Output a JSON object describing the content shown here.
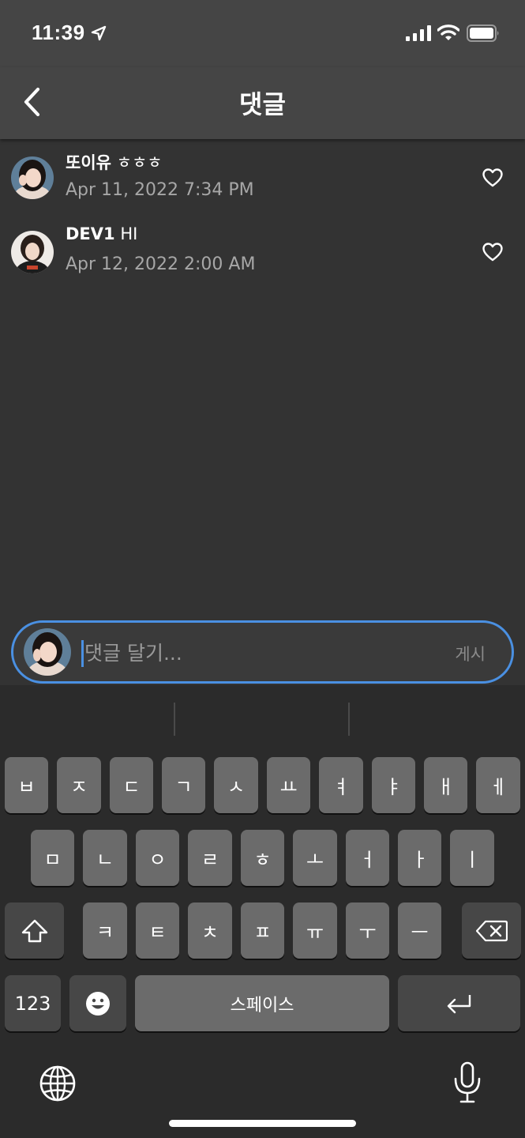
{
  "status_bar": {
    "time": "11:39",
    "icons": [
      "location-arrow-icon",
      "cellular-signal-icon",
      "wifi-icon",
      "battery-icon"
    ]
  },
  "nav": {
    "title": "댓글",
    "back_icon": "chevron-left-icon"
  },
  "comments": [
    {
      "username": "또이유",
      "text": "ㅎㅎㅎ",
      "date": "Apr 11, 2022 7:34 PM",
      "liked": false
    },
    {
      "username": "DEV1",
      "text": "HI",
      "date": "Apr 12, 2022 2:00 AM",
      "liked": false
    }
  ],
  "input": {
    "placeholder": "댓글 달기...",
    "value": "",
    "post_label": "게시"
  },
  "keyboard": {
    "row1": [
      "ㅂ",
      "ㅈ",
      "ㄷ",
      "ㄱ",
      "ㅅ",
      "ㅛ",
      "ㅕ",
      "ㅑ",
      "ㅐ",
      "ㅔ"
    ],
    "row2": [
      "ㅁ",
      "ㄴ",
      "ㅇ",
      "ㄹ",
      "ㅎ",
      "ㅗ",
      "ㅓ",
      "ㅏ",
      "ㅣ"
    ],
    "row3": [
      "ㅋ",
      "ㅌ",
      "ㅊ",
      "ㅍ",
      "ㅠ",
      "ㅜ",
      "ㅡ"
    ],
    "numbers_label": "123",
    "space_label": "스페이스",
    "shift_icon": "shift-icon",
    "delete_icon": "backspace-icon",
    "return_icon": "return-icon",
    "emoji_icon": "emoji-icon",
    "globe_icon": "globe-icon",
    "mic_icon": "microphone-icon"
  },
  "colors": {
    "background": "#333333",
    "header": "#454545",
    "accent": "#4a90e2",
    "secondary_text": "#a7a7a7",
    "key": "#6b6b6b",
    "key_dark": "#474747",
    "keyboard_bg": "#2b2b2b"
  }
}
